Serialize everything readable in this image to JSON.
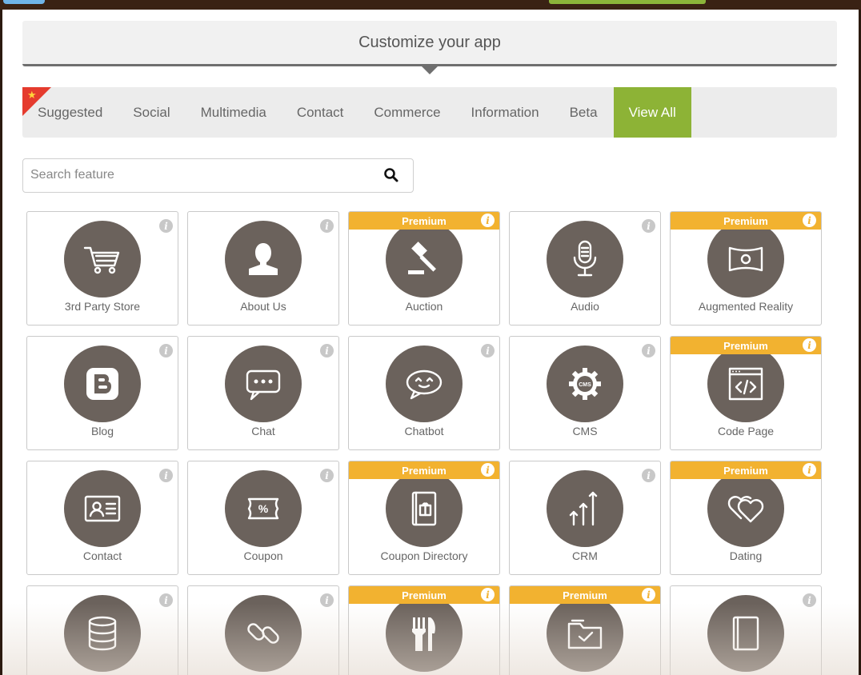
{
  "header": {
    "title": "Customize your app"
  },
  "tabs": [
    {
      "label": "Suggested"
    },
    {
      "label": "Social"
    },
    {
      "label": "Multimedia"
    },
    {
      "label": "Contact"
    },
    {
      "label": "Commerce"
    },
    {
      "label": "Information"
    },
    {
      "label": "Beta"
    },
    {
      "label": "View All",
      "active": true
    }
  ],
  "search": {
    "placeholder": "Search feature"
  },
  "premium_label": "Premium",
  "info_glyph": "i",
  "colors": {
    "accent_green": "#8db336",
    "premium_orange": "#f2b230",
    "icon_circle": "#6b625c",
    "ribbon_red": "#e53b2e"
  },
  "features": [
    {
      "label": "3rd Party Store",
      "icon": "cart-icon",
      "premium": false
    },
    {
      "label": "About Us",
      "icon": "person-icon",
      "premium": false
    },
    {
      "label": "Auction",
      "icon": "gavel-icon",
      "premium": true
    },
    {
      "label": "Audio",
      "icon": "microphone-icon",
      "premium": false
    },
    {
      "label": "Augmented Reality",
      "icon": "ar-frame-icon",
      "premium": true
    },
    {
      "label": "Blog",
      "icon": "blogger-icon",
      "premium": false
    },
    {
      "label": "Chat",
      "icon": "chat-bubble-icon",
      "premium": false
    },
    {
      "label": "Chatbot",
      "icon": "chatbot-icon",
      "premium": false
    },
    {
      "label": "CMS",
      "icon": "cms-gear-icon",
      "premium": false
    },
    {
      "label": "Code Page",
      "icon": "code-window-icon",
      "premium": true
    },
    {
      "label": "Contact",
      "icon": "id-card-icon",
      "premium": false
    },
    {
      "label": "Coupon",
      "icon": "coupon-icon",
      "premium": false
    },
    {
      "label": "Coupon Directory",
      "icon": "coupon-book-icon",
      "premium": true
    },
    {
      "label": "CRM",
      "icon": "arrows-up-icon",
      "premium": false
    },
    {
      "label": "Dating",
      "icon": "hearts-icon",
      "premium": true
    },
    {
      "label": "",
      "icon": "database-icon",
      "premium": false
    },
    {
      "label": "",
      "icon": "link-icon",
      "premium": false
    },
    {
      "label": "",
      "icon": "fork-knife-icon",
      "premium": true
    },
    {
      "label": "",
      "icon": "folder-check-icon",
      "premium": true
    },
    {
      "label": "",
      "icon": "book-icon",
      "premium": false
    }
  ]
}
